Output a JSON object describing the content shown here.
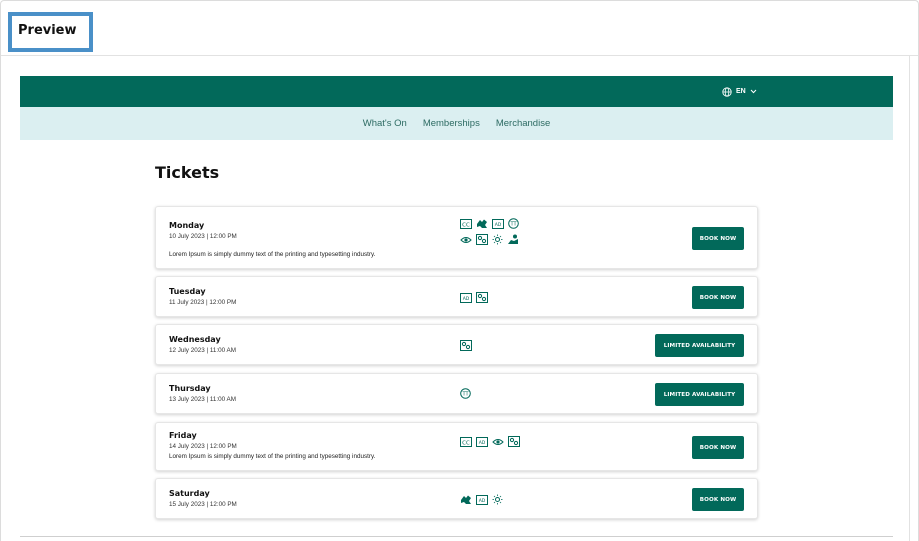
{
  "preview_label": "Preview",
  "language": {
    "code": "EN"
  },
  "nav": [
    "What's On",
    "Memberships",
    "Merchandise"
  ],
  "page_title": "Tickets",
  "colors": {
    "brand": "#02695a",
    "nav_bg": "#dbeff1",
    "nav_text": "#2d6b63",
    "preview_border": "#4a90c8"
  },
  "tickets": [
    {
      "day": "Monday",
      "datetime": "10 July 2023 | 12:00 PM",
      "description": "Lorem Ipsum is simply dummy text of the printing and typesetting industry.",
      "icons": [
        "cc-icon",
        "sign-language-icon",
        "audio-description-icon",
        "tt-icon",
        "eye-icon",
        "relaxed-icon",
        "sun-icon",
        "touch-tour-icon"
      ],
      "button": "BOOK NOW"
    },
    {
      "day": "Tuesday",
      "datetime": "11 July 2023 | 12:00 PM",
      "description": "",
      "icons": [
        "audio-description-icon",
        "relaxed-icon"
      ],
      "button": "BOOK NOW"
    },
    {
      "day": "Wednesday",
      "datetime": "12 July 2023 | 11:00 AM",
      "description": "",
      "icons": [
        "relaxed-icon"
      ],
      "button": "LIMITED AVAILABILITY"
    },
    {
      "day": "Thursday",
      "datetime": "13 July 2023 | 11:00 AM",
      "description": "",
      "icons": [
        "tt-icon"
      ],
      "button": "LIMITED AVAILABILITY"
    },
    {
      "day": "Friday",
      "datetime": "14 July 2023 | 12:00 PM",
      "description": "Lorem Ipsum is simply dummy text of the printing and typesetting industry.",
      "icons": [
        "cc-icon",
        "audio-description-icon",
        "eye-icon",
        "relaxed-icon"
      ],
      "button": "BOOK NOW"
    },
    {
      "day": "Saturday",
      "datetime": "15 July 2023 | 12:00 PM",
      "description": "",
      "icons": [
        "sign-language-icon",
        "audio-description-icon",
        "sun-icon"
      ],
      "button": "BOOK NOW"
    }
  ]
}
